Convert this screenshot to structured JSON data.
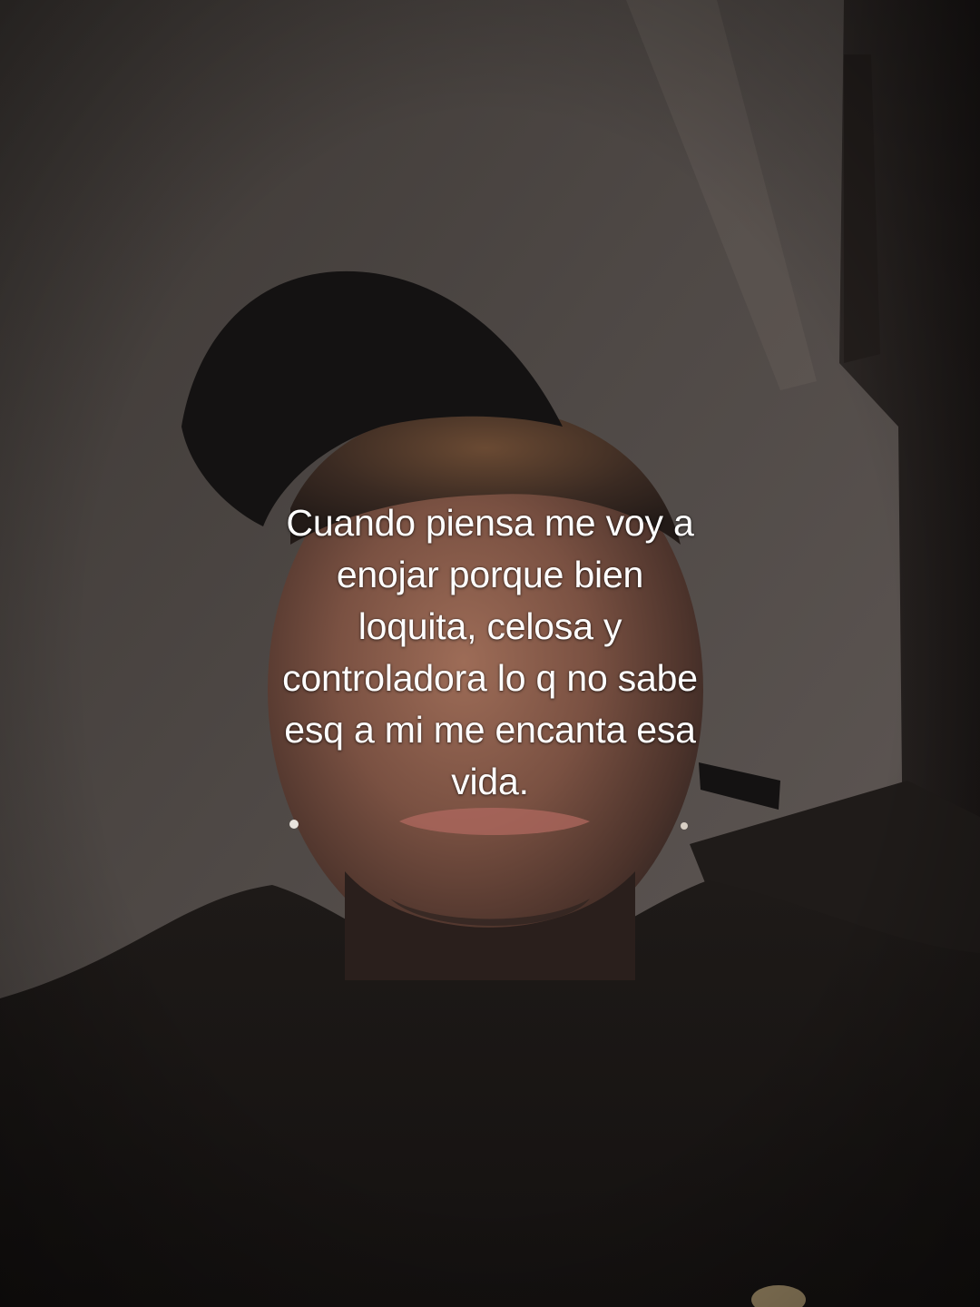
{
  "caption": {
    "lines": [
      "Cuando piensa me voy a",
      "enojar porque bien",
      "loquita, celosa y",
      "controladora lo q no sabe",
      "esq a mi me encanta esa",
      "vida."
    ]
  },
  "colors": {
    "caption_text": "#ffffff",
    "wall": "#4a4441",
    "shadow": "#1c1917",
    "cap": "#141212",
    "skin_warm": "#9a6a55"
  }
}
